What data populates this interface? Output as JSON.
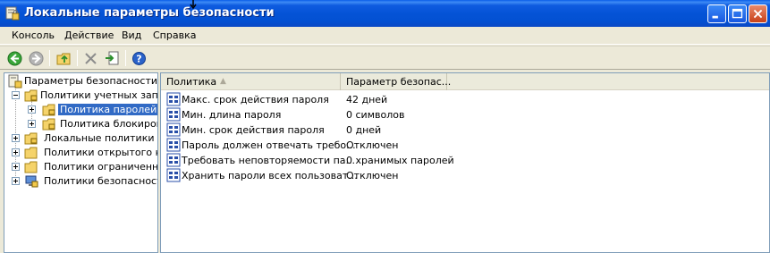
{
  "window": {
    "title": "Локальные параметры безопасности"
  },
  "menu": [
    "Консоль",
    "Действие",
    "Вид",
    "Справка"
  ],
  "toolbar": {
    "buttons": [
      "back-icon",
      "forward-icon",
      "up-folder-icon",
      "delete-icon",
      "export-icon",
      "help-icon"
    ]
  },
  "tree": {
    "root": "Параметры безопасности",
    "items": [
      {
        "label": "Политики учетных запис",
        "expanded": true
      },
      {
        "label": "Политика паролей",
        "selected": true
      },
      {
        "label": "Политика блокировк"
      },
      {
        "label": "Локальные политики"
      },
      {
        "label": "Политики открытого клн"
      },
      {
        "label": "Политики ограниченного"
      },
      {
        "label": "Политики безопасности :"
      }
    ]
  },
  "list": {
    "columns": [
      "Политика",
      "Параметр безопас..."
    ],
    "rows": [
      {
        "policy": "Макс. срок действия пароля",
        "value": "42 дней"
      },
      {
        "policy": "Мин. длина пароля",
        "value": "0 символов"
      },
      {
        "policy": "Мин. срок действия пароля",
        "value": "0 дней"
      },
      {
        "policy": "Пароль должен отвечать требо...",
        "value": "Отключен"
      },
      {
        "policy": "Требовать неповторяемости па...",
        "value": "0 хранимых паролей"
      },
      {
        "policy": "Хранить пароли всех пользоват...",
        "value": "Отключен"
      }
    ]
  },
  "colors": {
    "titlebar": "#0453d6",
    "selection": "#316ac5",
    "pane_border": "#7f9db9"
  }
}
